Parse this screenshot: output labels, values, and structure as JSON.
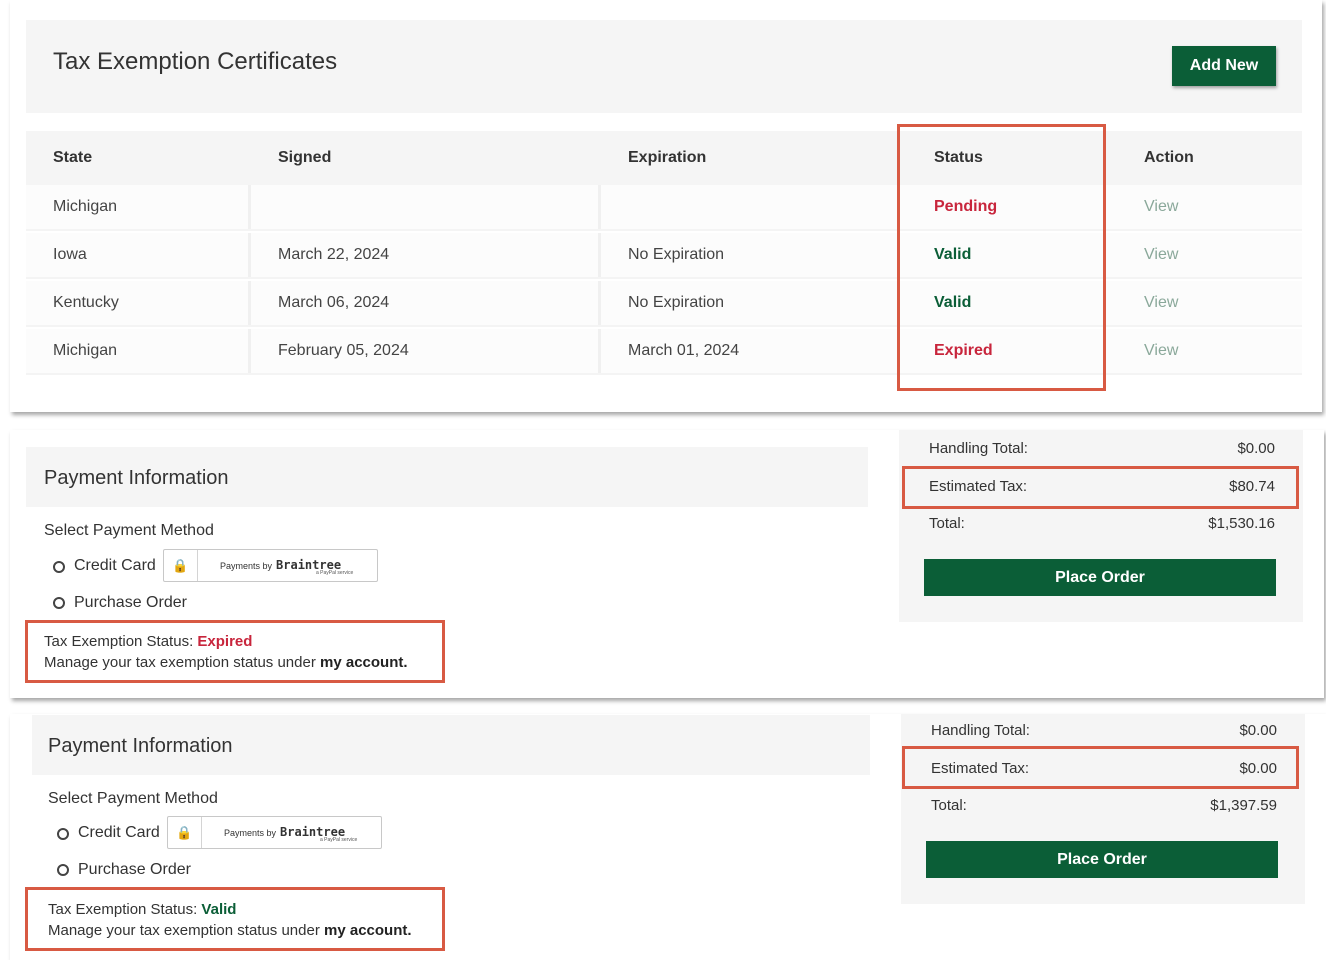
{
  "certificates": {
    "title": "Tax Exemption Certificates",
    "add_new_label": "Add New",
    "columns": {
      "state": "State",
      "signed": "Signed",
      "expiration": "Expiration",
      "status": "Status",
      "action": "Action"
    },
    "rows": [
      {
        "state": "Michigan",
        "signed": "",
        "expiration": "",
        "status": "Pending",
        "action": "View"
      },
      {
        "state": "Iowa",
        "signed": "March 22, 2024",
        "expiration": "No Expiration",
        "status": "Valid",
        "action": "View"
      },
      {
        "state": "Kentucky",
        "signed": "March 06, 2024",
        "expiration": "No Expiration",
        "status": "Valid",
        "action": "View"
      },
      {
        "state": "Michigan",
        "signed": "February 05, 2024",
        "expiration": "March 01, 2024",
        "status": "Expired",
        "action": "View"
      }
    ]
  },
  "payment_expired": {
    "title": "Payment Information",
    "select_method_label": "Select Payment Method",
    "credit_card_label": "Credit Card",
    "purchase_order_label": "Purchase Order",
    "braintree_prefix": "Payments by",
    "braintree_brand": "Braintree",
    "braintree_sub": "a PayPal service",
    "status_prefix": "Tax Exemption Status:",
    "status_value": "Expired",
    "manage_text": "Manage your tax exemption status under",
    "manage_link": "my account.",
    "summary": {
      "handling_label": "Handling Total:",
      "handling_value": "$0.00",
      "tax_label": "Estimated Tax:",
      "tax_value": "$80.74",
      "total_label": "Total:",
      "total_value": "$1,530.16",
      "place_order_label": "Place Order"
    }
  },
  "payment_valid": {
    "title": "Payment Information",
    "select_method_label": "Select Payment Method",
    "credit_card_label": "Credit Card",
    "purchase_order_label": "Purchase Order",
    "braintree_prefix": "Payments by",
    "braintree_brand": "Braintree",
    "braintree_sub": "a PayPal service",
    "status_prefix": "Tax Exemption Status:",
    "status_value": "Valid",
    "manage_text": "Manage your tax exemption status under",
    "manage_link": "my account.",
    "summary": {
      "handling_label": "Handling Total:",
      "handling_value": "$0.00",
      "tax_label": "Estimated Tax:",
      "tax_value": "$0.00",
      "total_label": "Total:",
      "total_value": "$1,397.59",
      "place_order_label": "Place Order"
    }
  },
  "colors": {
    "brand_green": "#0b5e37",
    "status_red": "#c8253c",
    "highlight_border": "#d85a43",
    "panel_gray": "#f5f5f5"
  }
}
